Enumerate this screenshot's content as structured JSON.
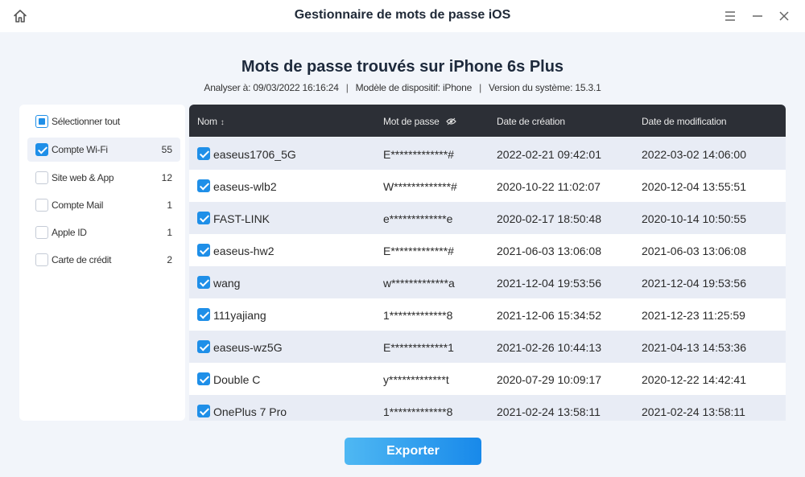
{
  "window": {
    "title": "Gestionnaire de mots de passe iOS"
  },
  "heading": "Mots de passe trouvés sur iPhone 6s Plus",
  "meta": {
    "scan": "Analyser à: 09/03/2022 16:16:24",
    "model": "Modèle de dispositif: iPhone",
    "version": "Version du système: 15.3.1",
    "separator": "|"
  },
  "sidebar": {
    "select_all": "Sélectionner tout",
    "items": [
      {
        "label": "Compte Wi-Fi",
        "count": "55",
        "checked": true
      },
      {
        "label": "Site web & App",
        "count": "12",
        "checked": false
      },
      {
        "label": "Compte Mail",
        "count": "1",
        "checked": false
      },
      {
        "label": "Apple ID",
        "count": "1",
        "checked": false
      },
      {
        "label": "Carte de crédit",
        "count": "2",
        "checked": false
      }
    ]
  },
  "table": {
    "headers": {
      "name": "Nom",
      "name_sort_icon": "sort-icon",
      "password": "Mot de passe",
      "password_icon": "eye-icon",
      "created": "Date de création",
      "modified": "Date de modification"
    },
    "rows": [
      {
        "name": "easeus1706_5G",
        "password": "E*************#",
        "created": "2022-02-21 09:42:01",
        "modified": "2022-03-02 14:06:00"
      },
      {
        "name": "easeus-wlb2",
        "password": "W*************#",
        "created": "2020-10-22 11:02:07",
        "modified": "2020-12-04 13:55:51"
      },
      {
        "name": "FAST-LINK",
        "password": "e*************e",
        "created": "2020-02-17 18:50:48",
        "modified": "2020-10-14 10:50:55"
      },
      {
        "name": "easeus-hw2",
        "password": "E*************#",
        "created": "2021-06-03 13:06:08",
        "modified": "2021-06-03 13:06:08"
      },
      {
        "name": "wang",
        "password": "w*************a",
        "created": "2021-12-04 19:53:56",
        "modified": "2021-12-04 19:53:56"
      },
      {
        "name": "111yajiang",
        "password": "1*************8",
        "created": "2021-12-06 15:34:52",
        "modified": "2021-12-23 11:25:59"
      },
      {
        "name": "easeus-wz5G",
        "password": "E*************1",
        "created": "2021-02-26 10:44:13",
        "modified": "2021-04-13 14:53:36"
      },
      {
        "name": "Double C",
        "password": "y*************t",
        "created": "2020-07-29 10:09:17",
        "modified": "2020-12-22 14:42:41"
      },
      {
        "name": "OnePlus 7 Pro",
        "password": "1*************8",
        "created": "2021-02-24 13:58:11",
        "modified": "2021-02-24 13:58:11"
      }
    ]
  },
  "export_label": "Exporter",
  "colors": {
    "accent": "#1f8fe8",
    "header_bg": "#2c2f36",
    "row_alt": "#e8ecf5",
    "background": "#f2f5fa"
  },
  "icons": {
    "home": "home-icon",
    "menu": "menu-icon",
    "minimize": "minimize-icon",
    "close": "close-icon"
  }
}
